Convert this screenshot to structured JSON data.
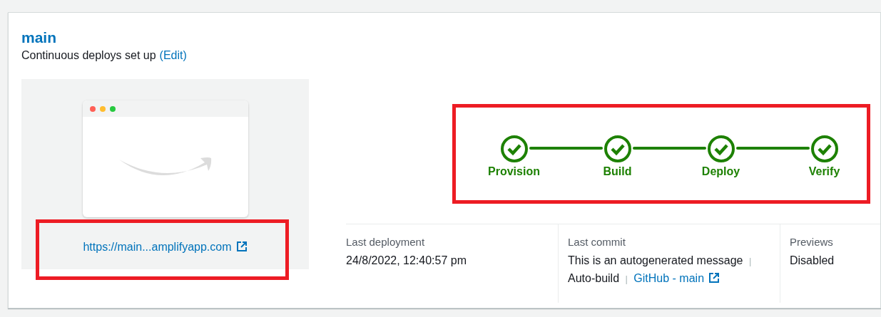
{
  "branch": {
    "name": "main",
    "subtitle": "Continuous deploys set up",
    "edit_link": "(Edit)"
  },
  "preview": {
    "url": "https://main...amplifyapp.com",
    "highlighted": true
  },
  "pipeline": {
    "highlighted": true,
    "steps": [
      {
        "label": "Provision",
        "complete": true
      },
      {
        "label": "Build",
        "complete": true
      },
      {
        "label": "Deploy",
        "complete": true
      },
      {
        "label": "Verify",
        "complete": true
      }
    ]
  },
  "details": [
    {
      "kind": "text",
      "label": "Last deployment",
      "value": "24/8/2022, 12:40:57 pm"
    },
    {
      "kind": "commit",
      "label": "Last commit",
      "parts": [
        {
          "kind": "text",
          "text": "This is an autogenerated message"
        },
        {
          "kind": "separator",
          "text": "|"
        },
        {
          "kind": "text",
          "text": "Auto-build"
        },
        {
          "kind": "separator",
          "text": "|"
        },
        {
          "kind": "link",
          "text": "GitHub - main"
        }
      ]
    },
    {
      "kind": "text",
      "label": "Previews",
      "value": "Disabled"
    }
  ]
}
